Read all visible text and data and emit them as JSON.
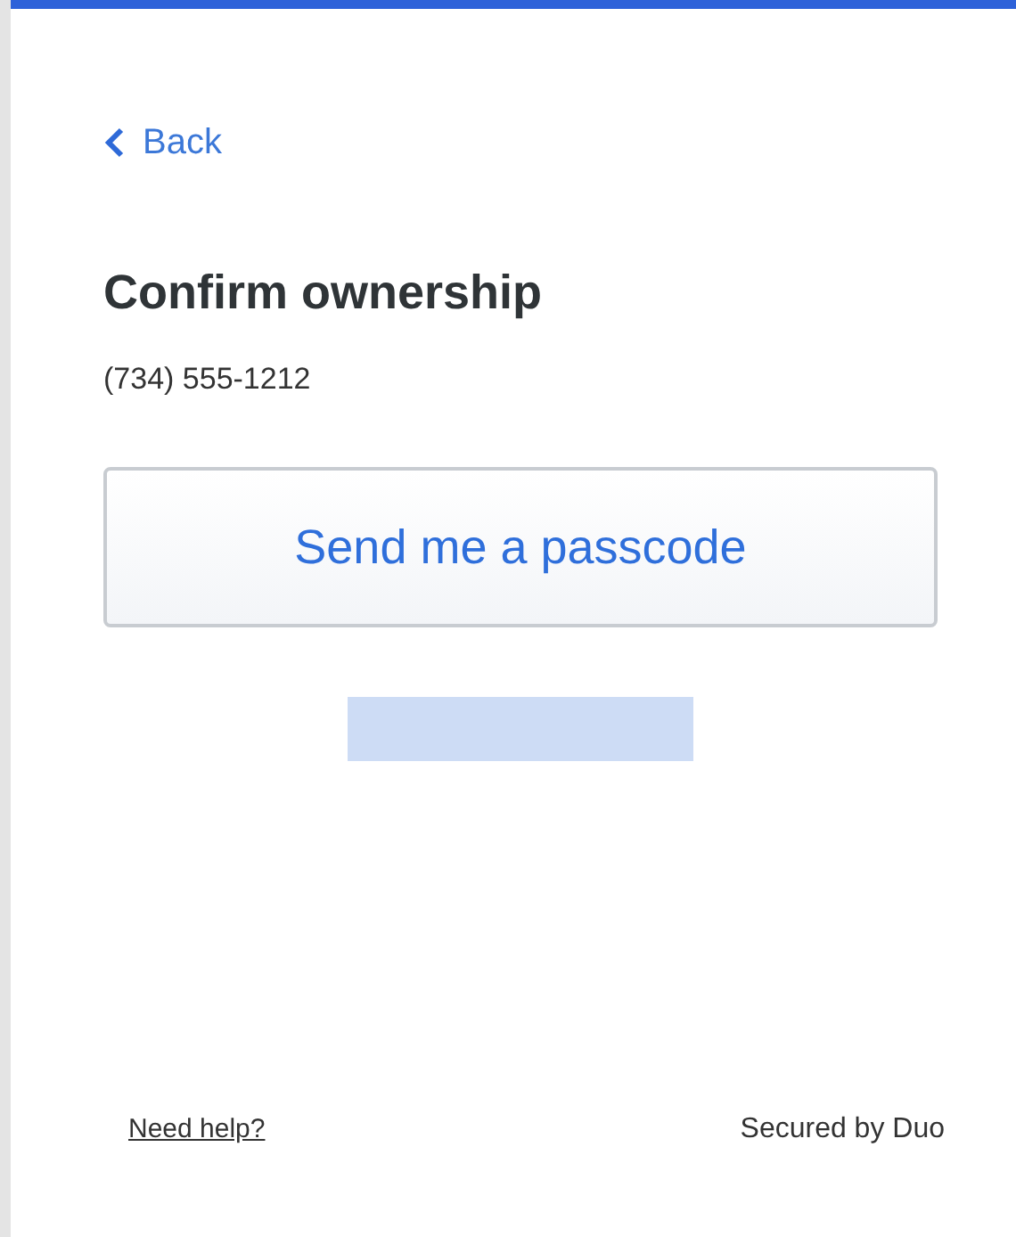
{
  "back_link": "Back",
  "heading": "Confirm ownership",
  "phone_number": "(734) 555-1212",
  "send_button": "Send me a passcode",
  "footer": {
    "help_link": "Need help?",
    "secured_by": "Secured by Duo"
  }
}
